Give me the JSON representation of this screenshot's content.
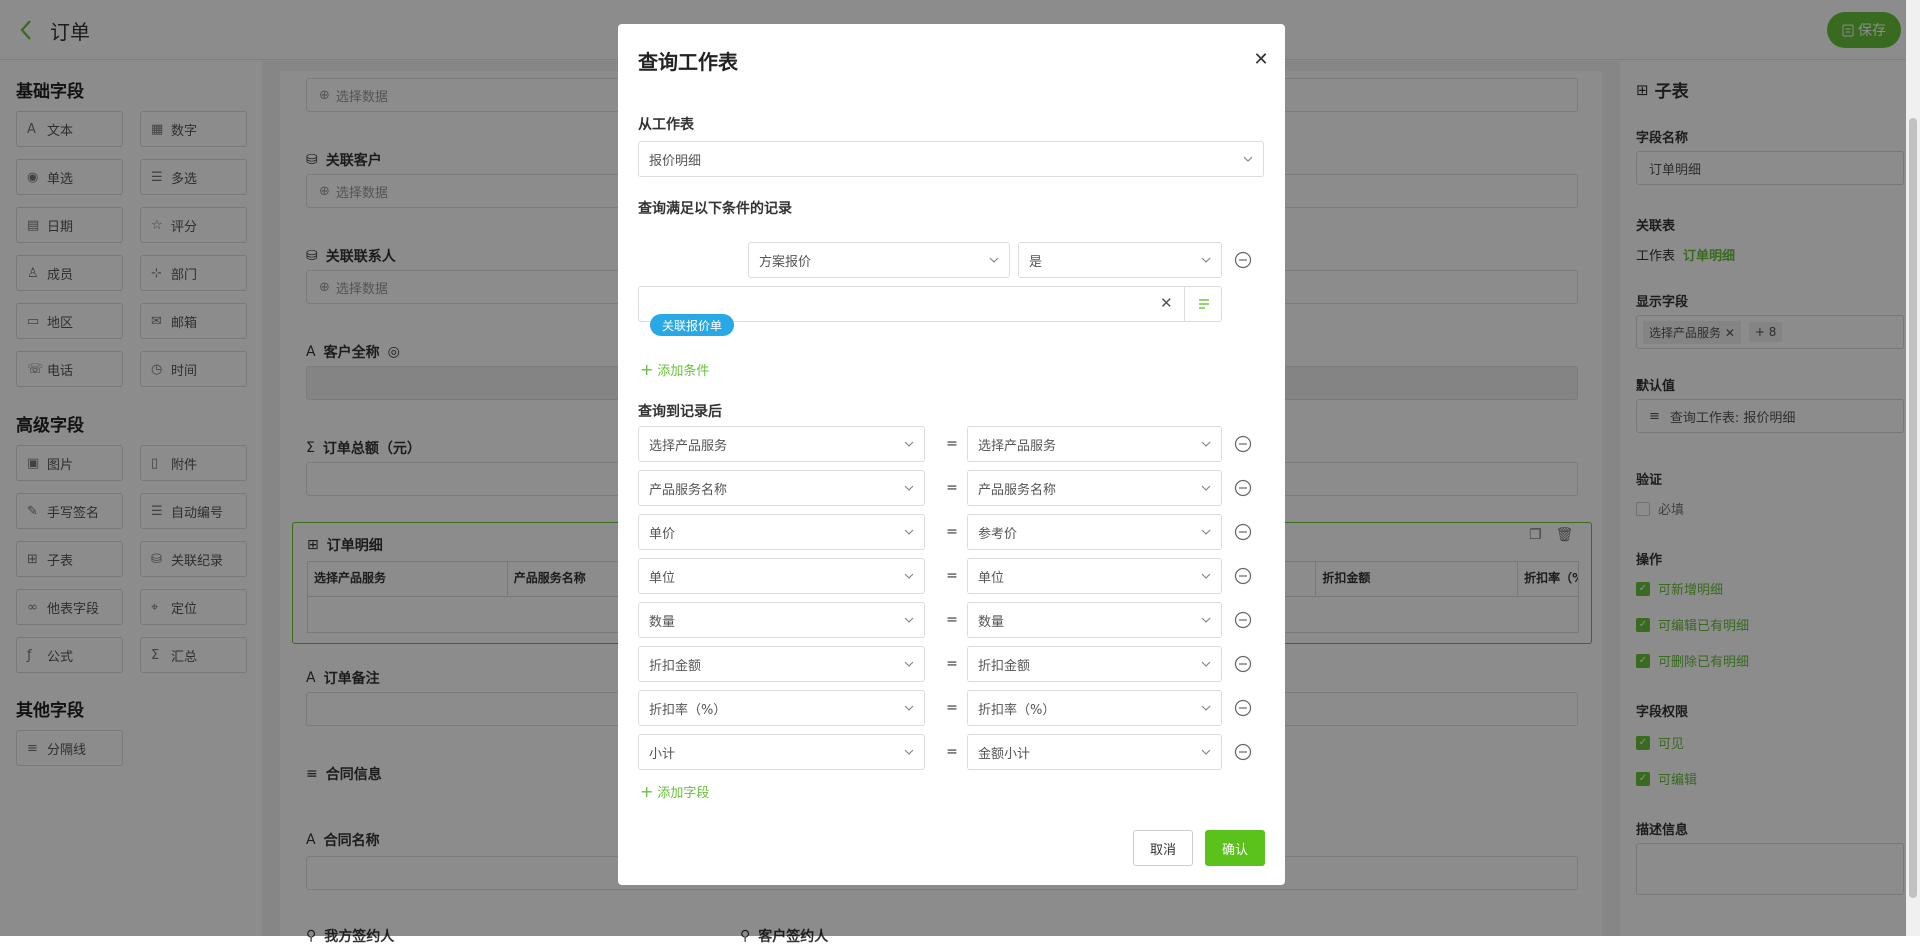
{
  "header": {
    "title": "订单",
    "save_label": "保存"
  },
  "left": {
    "basic_title": "基础字段",
    "basic": [
      {
        "label": "文本",
        "icon": "text-icon"
      },
      {
        "label": "数字",
        "icon": "number-icon"
      },
      {
        "label": "单选",
        "icon": "radio-icon"
      },
      {
        "label": "多选",
        "icon": "list-icon"
      },
      {
        "label": "日期",
        "icon": "calendar-icon"
      },
      {
        "label": "评分",
        "icon": "rating-icon"
      },
      {
        "label": "成员",
        "icon": "user-icon"
      },
      {
        "label": "部门",
        "icon": "org-icon"
      },
      {
        "label": "地区",
        "icon": "map-icon"
      },
      {
        "label": "邮箱",
        "icon": "mail-icon"
      },
      {
        "label": "电话",
        "icon": "phone-icon"
      },
      {
        "label": "时间",
        "icon": "clock-icon"
      }
    ],
    "advanced_title": "高级字段",
    "advanced": [
      {
        "label": "图片",
        "icon": "image-icon"
      },
      {
        "label": "附件",
        "icon": "file-icon"
      },
      {
        "label": "手写签名",
        "icon": "pen-icon"
      },
      {
        "label": "自动编号",
        "icon": "numbered-list-icon"
      },
      {
        "label": "子表",
        "icon": "table-icon"
      },
      {
        "label": "关联纪录",
        "icon": "database-icon"
      },
      {
        "label": "他表字段",
        "icon": "link-icon"
      },
      {
        "label": "定位",
        "icon": "location-icon"
      },
      {
        "label": "公式",
        "icon": "formula-icon"
      },
      {
        "label": "汇总",
        "icon": "sum-icon"
      }
    ],
    "other_title": "其他字段",
    "other": [
      {
        "label": "分隔线",
        "icon": "divider-icon"
      }
    ]
  },
  "canvas": {
    "select_data": "选择数据",
    "customer_label": "关联客户",
    "contact_label": "关联联系人",
    "fullname_label": "客户全称",
    "total_label": "订单总额（元）",
    "detail_label": "订单明细",
    "detail_columns": [
      "选择产品服务",
      "产品服务名称",
      "",
      "",
      "",
      "折扣金额",
      "折扣率（%）"
    ],
    "remark_label": "订单备注",
    "contract_info_label": "合同信息",
    "contract_name_label": "合同名称",
    "our_signer_label": "我方签约人",
    "cust_signer_label": "客户签约人"
  },
  "right": {
    "title": "子表",
    "field_name_label": "字段名称",
    "field_name_value": "订单明细",
    "rel_label": "关联表",
    "rel_prefix": "工作表",
    "rel_value": "订单明细",
    "display_label": "显示字段",
    "display_tag": "选择产品服务",
    "display_more": "+ 8",
    "default_label": "默认值",
    "default_value": "查询工作表: 报价明细",
    "validate_label": "验证",
    "required_label": "必填",
    "ops_label": "操作",
    "ops": [
      "可新增明细",
      "可编辑已有明细",
      "可删除已有明细"
    ],
    "perm_label": "字段权限",
    "perms": [
      "可见",
      "可编辑"
    ],
    "desc_label": "描述信息"
  },
  "modal": {
    "title": "查询工作表",
    "from_label": "从工作表",
    "from_value": "报价明细",
    "cond_label": "查询满足以下条件的记录",
    "cond_field": "方案报价",
    "cond_op": "是",
    "cond_tag": "关联报价单",
    "add_cond": "添加条件",
    "after_label": "查询到记录后",
    "mappings": [
      {
        "left": "选择产品服务",
        "right": "选择产品服务"
      },
      {
        "left": "产品服务名称",
        "right": "产品服务名称"
      },
      {
        "left": "单价",
        "right": "参考价"
      },
      {
        "left": "单位",
        "right": "单位"
      },
      {
        "left": "数量",
        "right": "数量"
      },
      {
        "left": "折扣金额",
        "right": "折扣金额"
      },
      {
        "left": "折扣率（%）",
        "right": "折扣率（%）"
      },
      {
        "left": "小计",
        "right": "金额小计"
      }
    ],
    "add_field": "添加字段",
    "cancel": "取消",
    "confirm": "确认"
  }
}
